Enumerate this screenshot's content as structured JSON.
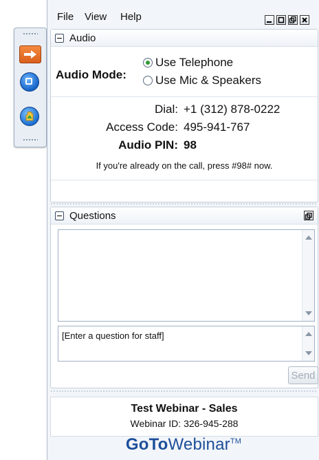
{
  "menu": [
    "File",
    "View",
    "Help"
  ],
  "audio": {
    "title": "Audio",
    "mode_label": "Audio Mode:",
    "options": [
      {
        "label": "Use Telephone",
        "selected": true
      },
      {
        "label": "Use Mic & Speakers",
        "selected": false
      }
    ],
    "dial_label": "Dial:",
    "dial_value": "+1 (312) 878-0222",
    "access_label": "Access Code:",
    "access_value": "495-941-767",
    "pin_label": "Audio PIN:",
    "pin_value": "98",
    "note": "If you're already on the call, press #98# now."
  },
  "questions": {
    "title": "Questions",
    "input_text": "[Enter a question for staff]",
    "send_label": "Send"
  },
  "footer": {
    "title": "Test Webinar - Sales",
    "webinar_id": "Webinar ID: 326-945-288"
  },
  "brand": {
    "go": "GoTo",
    "rest": "Webinar",
    "tm": "TM"
  },
  "colors": {
    "brand": "#1d4f9a",
    "accent_orange": "#e8722d",
    "radio_on": "#2f9a2f"
  }
}
